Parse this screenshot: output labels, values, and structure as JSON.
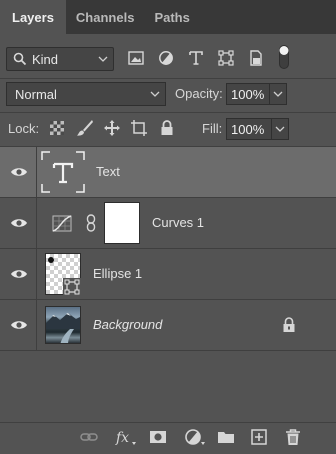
{
  "tabs": [
    {
      "label": "Layers",
      "active": true
    },
    {
      "label": "Channels",
      "active": false
    },
    {
      "label": "Paths",
      "active": false
    }
  ],
  "filter": {
    "kind_label": "Kind",
    "icons": [
      "image-filter-icon",
      "adjustment-filter-icon",
      "type-filter-icon",
      "shape-filter-icon",
      "smart-object-filter-icon"
    ],
    "toggle_icon": "filter-toggle-icon"
  },
  "blend": {
    "mode": "Normal",
    "opacity_label": "Opacity:",
    "opacity_value": "100%"
  },
  "lock": {
    "label": "Lock:",
    "icons": [
      "lock-transparent-pixels-icon",
      "lock-image-pixels-icon",
      "lock-position-icon",
      "lock-artboard-icon",
      "lock-all-icon"
    ],
    "fill_label": "Fill:",
    "fill_value": "100%"
  },
  "layers": [
    {
      "name": "Text",
      "type": "text",
      "visible": true,
      "selected": true
    },
    {
      "name": "Curves 1",
      "type": "adjustment",
      "visible": true,
      "selected": false
    },
    {
      "name": "Ellipse 1",
      "type": "shape",
      "visible": true,
      "selected": false
    },
    {
      "name": "Background",
      "type": "image",
      "visible": true,
      "selected": false,
      "locked": true
    }
  ],
  "footer_icons": [
    "link-layers-icon",
    "layer-style-fx-icon",
    "add-mask-icon",
    "new-fill-adjustment-icon",
    "new-group-icon",
    "new-layer-icon",
    "delete-layer-icon"
  ],
  "colors": {
    "panel_bg": "#535353",
    "tab_bar_bg": "#383838",
    "selected_layer_bg": "#6c6c6c"
  }
}
